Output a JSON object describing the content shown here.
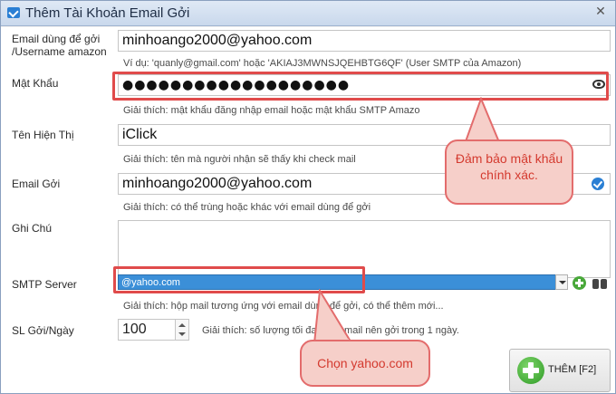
{
  "window": {
    "title": "Thêm Tài Khoản Email Gởi",
    "close_glyph": "✕"
  },
  "form": {
    "email_login": {
      "label_line1": "Email dùng để gởi",
      "label_line2": "/Username amazon",
      "value": "minhoango2000@yahoo.com",
      "hint": "Ví dụ: 'quanly@gmail.com' hoặc 'AKIAJ3MWNSJQEHBTG6QF' (User SMTP của Amazon)"
    },
    "password": {
      "label": "Mật Khẩu",
      "value_masked": "●●●●●●●●●●●●●●●●●●●",
      "hint": "Giải thích: mật khẩu đăng nhập email hoặc mật khẩu SMTP Amazo",
      "icon": "eye-icon"
    },
    "display_name": {
      "label": "Tên Hiện Thị",
      "value": "iClick",
      "hint": "Giải thích: tên mà người nhận sẽ thấy khi check mail"
    },
    "sender_email": {
      "label": "Email Gởi",
      "value": "minhoango2000@yahoo.com",
      "hint": "Giải thích: có thể trùng hoặc khác với email dùng để gởi",
      "icon": "check-circle-icon"
    },
    "notes": {
      "label": "Ghi Chú",
      "value": ""
    },
    "smtp_server": {
      "label": "SMTP Server",
      "selected": "@yahoo.com",
      "hint": "Giải thích: hộp mail tương ứng với email dùng để gởi, có thể thêm mới..."
    },
    "daily_limit": {
      "label": "SL Gởi/Ngày",
      "value": "100",
      "hint": "Giải thích: số lượng tối đa một email nên gởi trong 1 ngày."
    }
  },
  "add_button": {
    "label": "THÊM [F2]"
  },
  "annotations": {
    "callout_password": "Đảm bảo mật khẩu chính xác.",
    "callout_smtp": "Chọn yahoo.com",
    "color": "#e04b4b"
  }
}
